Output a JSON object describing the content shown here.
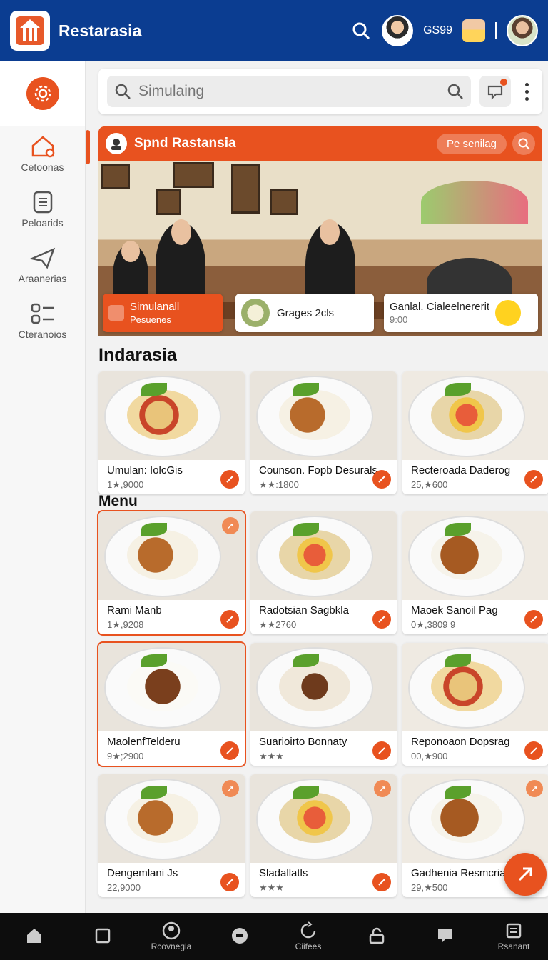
{
  "app": {
    "title": "Restarasia",
    "code": "GS99"
  },
  "search": {
    "placeholder": "Simulaing"
  },
  "sidebar": {
    "items": [
      {
        "label": "Cetoonas",
        "icon": "home-gear-icon"
      },
      {
        "label": "Peloarids",
        "icon": "document-icon"
      },
      {
        "label": "Araanerias",
        "icon": "send-icon"
      },
      {
        "label": "Cteranoios",
        "icon": "list-icon"
      }
    ]
  },
  "banner": {
    "title": "Spnd Rastansia",
    "pill": "Pe senilag",
    "cards": [
      {
        "line1": "Simulanall",
        "line2": "Pesuenes"
      },
      {
        "line1": "Grages 2cls"
      },
      {
        "line1": "Ganlal. Cialeelnererit",
        "line2": "9:00"
      }
    ]
  },
  "sections": {
    "featured_title": "Indarasia",
    "menu_title": "Menu"
  },
  "featured": [
    {
      "name": "Umulan: IolcGis",
      "price": "1★,9000"
    },
    {
      "name": "Counson. Fopb Desurals",
      "price": "★★:1800"
    },
    {
      "name": "Recteroada Daderog",
      "price": "25,★600"
    }
  ],
  "menu": [
    {
      "name": "Rami Manb",
      "price": "1★,9208"
    },
    {
      "name": "Radotsian Sagbkla",
      "price": "★★2760"
    },
    {
      "name": "Maoek Sanoil Pag",
      "price": "0★,3809 9"
    },
    {
      "name": "MaolenfTelderu",
      "price": "9★;2900"
    },
    {
      "name": "Suarioirto Bonnaty",
      "price": "★★★"
    },
    {
      "name": "Reponoaon Dopsrag",
      "price": "00,★900"
    },
    {
      "name": "Dengemlani Js",
      "price": "22,9000"
    },
    {
      "name": "Sladallatls",
      "price": "★★★"
    },
    {
      "name": "Gadhenia Resmcrial",
      "price": "29,★500"
    }
  ],
  "bottom_nav": [
    {
      "label": "",
      "icon": "home-icon"
    },
    {
      "label": "",
      "icon": "square-icon"
    },
    {
      "label": "Rcovnegla",
      "icon": "account-icon"
    },
    {
      "label": "",
      "icon": "record-icon"
    },
    {
      "label": "Ciifees",
      "icon": "refresh-icon"
    },
    {
      "label": "",
      "icon": "lock-icon"
    },
    {
      "label": "",
      "icon": "chat-icon"
    },
    {
      "label": "Rsanant",
      "icon": "receipt-icon"
    }
  ],
  "colors": {
    "brand_blue": "#0b3d91",
    "accent_orange": "#e8521f"
  }
}
